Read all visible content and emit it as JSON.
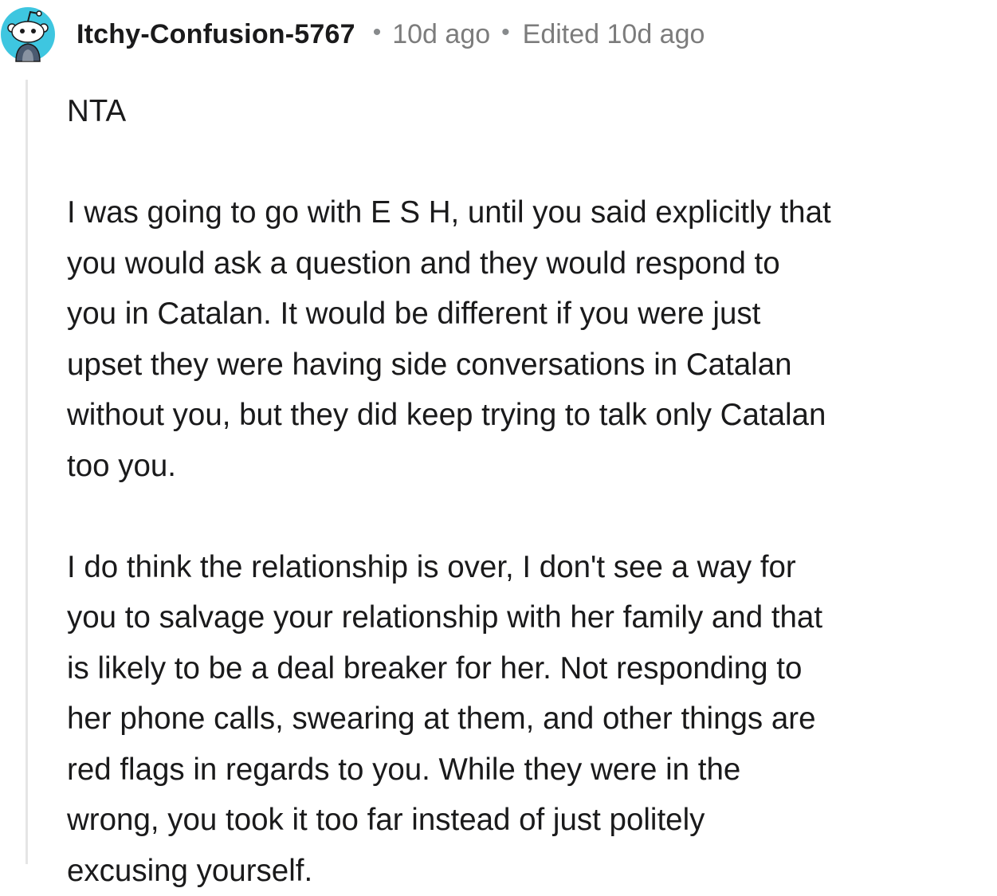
{
  "comment": {
    "author": "Itchy-Confusion-5767",
    "separator": "•",
    "posted_time": "10d ago",
    "edited_label": "Edited 10d ago",
    "avatar_icon": "snoo-avatar-icon",
    "colors": {
      "avatar_bg": "#3ec6e0",
      "meta_text": "#7c7c7c",
      "body_text": "#1a1a1b",
      "thread_line": "#e5e5e5"
    },
    "paragraphs": [
      "NTA",
      "I was going to go with E S H, until you said explicitly that\nyou would ask a question and they would respond to\nyou in Catalan. It would be different if you were just\nupset they were having side conversations in Catalan\nwithout you, but they did keep trying to talk only Catalan\ntoo you.",
      "I do think the relationship is over, I don't see a way for\nyou to salvage your relationship with her family and that\nis likely to be a deal breaker for her. Not responding to\nher phone calls, swearing at them, and other things are\nred flags in regards to you. While they were in the\nwrong, you took it too far instead of just politely\nexcusing yourself."
    ]
  }
}
